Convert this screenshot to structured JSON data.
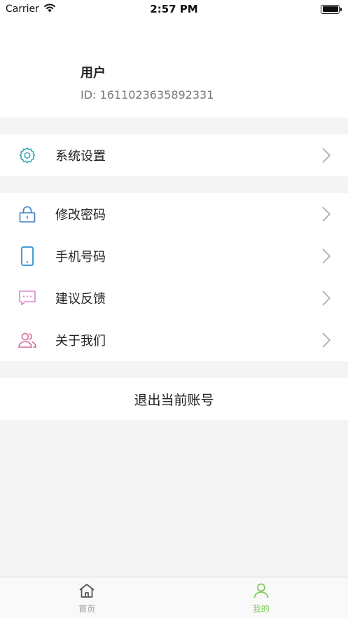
{
  "status_bar": {
    "carrier": "Carrier",
    "time": "2:57 PM",
    "battery_level": 1.0
  },
  "profile": {
    "name": "用户",
    "id_text": "ID: 1611023635892331"
  },
  "settings_section": {
    "items": [
      {
        "label": "系统设置",
        "icon": "gear-icon",
        "color": "#3aa8b4"
      }
    ]
  },
  "account_section": {
    "items": [
      {
        "label": "修改密码",
        "icon": "lock-icon",
        "color": "#3f7fc4"
      },
      {
        "label": "手机号码",
        "icon": "phone-icon",
        "color": "#2f8fd1"
      },
      {
        "label": "建议反馈",
        "icon": "message-icon",
        "color": "#d88ad4"
      },
      {
        "label": "关于我们",
        "icon": "users-icon",
        "color": "#d46a9a"
      }
    ]
  },
  "logout": {
    "label": "退出当前账号"
  },
  "tab_bar": {
    "tabs": [
      {
        "label": "首页",
        "icon": "home-icon",
        "color": "#999999"
      },
      {
        "label": "我的",
        "icon": "user-icon",
        "color": "#7ccb5a",
        "active": true
      }
    ]
  }
}
